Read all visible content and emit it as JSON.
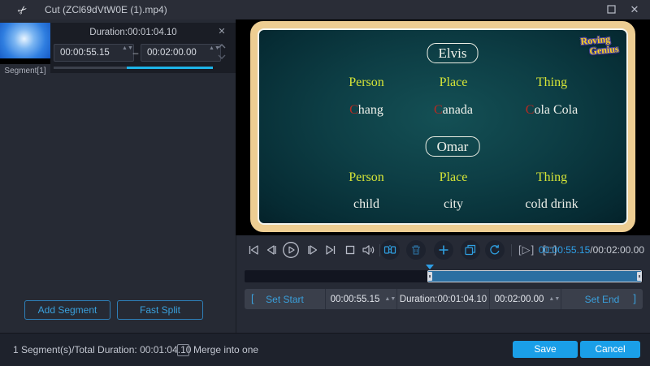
{
  "window": {
    "title": "Cut (ZCl69dVtW0E (1).mp4)",
    "icons": {
      "scissors": "✂",
      "maximize": "❒",
      "close": "✕"
    }
  },
  "colors": {
    "accent_blue": "#1a9fe8",
    "link_blue": "#3aa0dc",
    "cyan": "#1db4e8",
    "slide_border": "#edcd92",
    "slide_teal": "#145055",
    "header_green": "#d5e437",
    "lead_red": "#b62a22",
    "logo_yellow": "#f8d01f"
  },
  "segment_panel": {
    "thumbnail_label": "Segment[1]",
    "editor": {
      "duration_label": "Duration:00:01:04.10",
      "start_time": "00:00:55.15",
      "dash": "–",
      "end_time": "00:02:00.00",
      "close_icon": "✕",
      "spinner_up": "▲",
      "spinner_down": "▼"
    },
    "add_segment_label": "Add Segment",
    "fast_split_label": "Fast Split"
  },
  "preview": {
    "group1": {
      "badge": "Elvis",
      "headers": [
        "Person",
        "Place",
        "Thing"
      ],
      "words": [
        {
          "lead": "C",
          "rest": "hang"
        },
        {
          "lead": "C",
          "rest": "anada"
        },
        {
          "lead": "C",
          "rest": "ola Cola"
        }
      ]
    },
    "group2": {
      "badge": "Omar",
      "headers": [
        "Person",
        "Place",
        "Thing"
      ],
      "words": [
        {
          "lead": "",
          "rest": "child"
        },
        {
          "lead": "",
          "rest": "city"
        },
        {
          "lead": "",
          "rest": "cold drink"
        }
      ]
    },
    "watermark": {
      "line1": "Roving",
      "line2": "Genius"
    }
  },
  "transport": {
    "current_time": "00:00:55.15",
    "total_time": "/00:02:00.00",
    "play_segment_glyph": "[▷]",
    "stop_segment_glyph": "[□]"
  },
  "trim_bar": {
    "bracket_left": "[",
    "set_start_label": "Set Start",
    "start_value": "00:00:55.15",
    "duration_label": "Duration:00:01:04.10",
    "end_value": "00:02:00.00",
    "set_end_label": "Set End",
    "bracket_right": "]",
    "spinner_up": "▲",
    "spinner_down": "▼"
  },
  "footer": {
    "summary": "1 Segment(s)/Total Duration: 00:01:04.10",
    "merge_label": "Merge into one",
    "merge_checked": false,
    "save_label": "Save",
    "cancel_label": "Cancel"
  }
}
